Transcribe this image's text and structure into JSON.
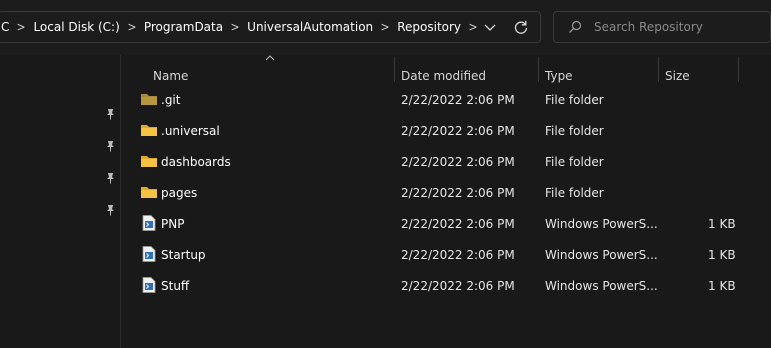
{
  "address_bar": {
    "breadcrumbs": [
      "C",
      "Local Disk (C:)",
      "ProgramData",
      "UniversalAutomation",
      "Repository"
    ],
    "dropdown_icon": "chevron-down-icon",
    "refresh_icon": "refresh-icon"
  },
  "search": {
    "placeholder": "Search Repository",
    "icon": "search-icon"
  },
  "columns": {
    "name": "Name",
    "date_modified": "Date modified",
    "type": "Type",
    "size": "Size"
  },
  "files": [
    {
      "name": ".git",
      "date": "2/22/2022 2:06 PM",
      "type": "File folder",
      "size": "",
      "icon": "folder-dim-icon"
    },
    {
      "name": ".universal",
      "date": "2/22/2022 2:06 PM",
      "type": "File folder",
      "size": "",
      "icon": "folder-icon"
    },
    {
      "name": "dashboards",
      "date": "2/22/2022 2:06 PM",
      "type": "File folder",
      "size": "",
      "icon": "folder-icon"
    },
    {
      "name": "pages",
      "date": "2/22/2022 2:06 PM",
      "type": "File folder",
      "size": "",
      "icon": "folder-icon"
    },
    {
      "name": "PNP",
      "date": "2/22/2022 2:06 PM",
      "type": "Windows PowerS...",
      "size": "1 KB",
      "icon": "powershell-file-icon"
    },
    {
      "name": "Startup",
      "date": "2/22/2022 2:06 PM",
      "type": "Windows PowerS...",
      "size": "1 KB",
      "icon": "powershell-file-icon"
    },
    {
      "name": "Stuff",
      "date": "2/22/2022 2:06 PM",
      "type": "Windows PowerS...",
      "size": "1 KB",
      "icon": "powershell-file-icon"
    }
  ],
  "colors": {
    "background": "#191919",
    "folder": "#f6c244",
    "folder_dim": "#a88a3c",
    "text": "#ffffff"
  }
}
